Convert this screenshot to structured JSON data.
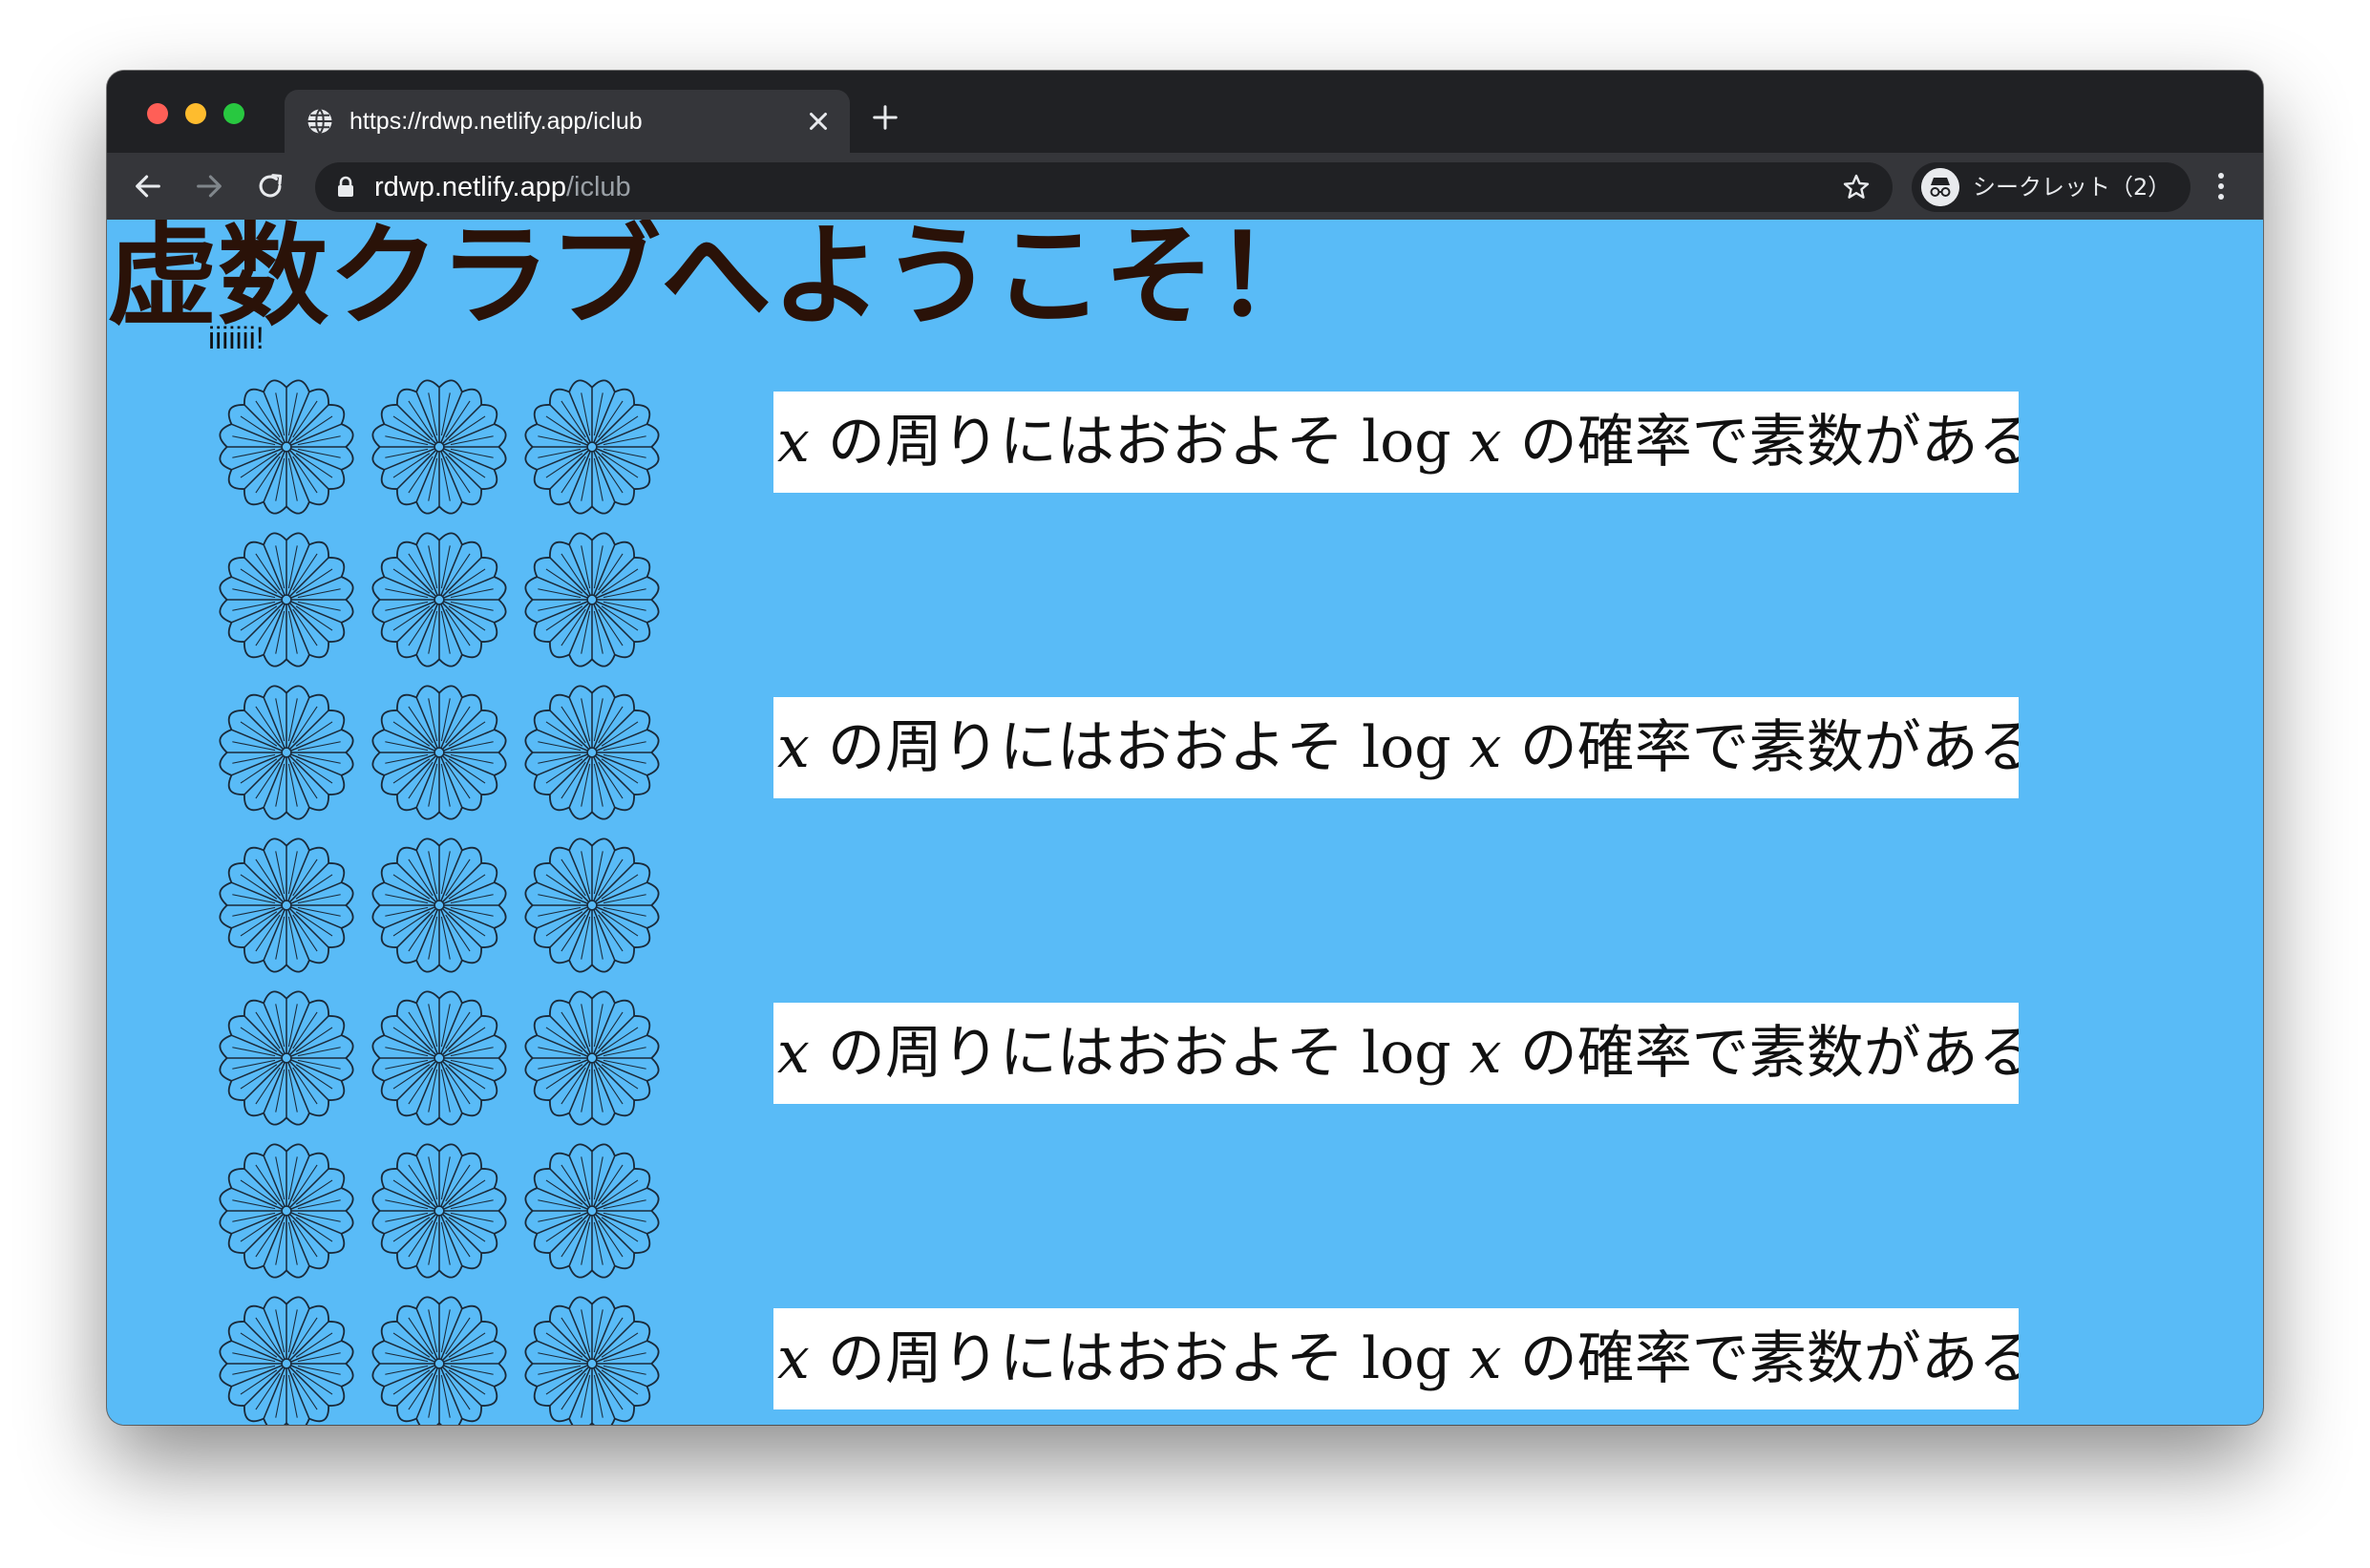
{
  "browser": {
    "tab_title": "https://rdwp.netlify.app/iclub",
    "url_host": "rdwp.netlify.app",
    "url_path": "/iclub",
    "profile_label": "シークレット（2）",
    "colors": {
      "frame": "#202124",
      "toolbar": "#35363a",
      "tab": "#35363a"
    }
  },
  "page": {
    "heading": "虚数クラブへようこそ！",
    "subtext": "iiiiiii!",
    "background": "#59bbf7",
    "rows": [
      {
        "banner_var": "x",
        "banner_text1": " の周りにはおおよそ log ",
        "banner_var2": "x",
        "banner_text2": " の確率で素数がある"
      },
      {},
      {
        "banner_var": "x",
        "banner_text1": " の周りにはおおよそ log ",
        "banner_var2": "x",
        "banner_text2": " の確率で素数がある"
      },
      {},
      {
        "banner_var": "x",
        "banner_text1": " の周りにはおおよそ log ",
        "banner_var2": "x",
        "banner_text2": " の確率で素数がある"
      },
      {},
      {
        "banner_var": "x",
        "banner_text1": " の周りにはおおよそ log ",
        "banner_var2": "x",
        "banner_text2": " の確率で素数がある"
      }
    ],
    "crest_icon": "chrysanthemum-crest-icon",
    "crests_per_row": 3
  }
}
